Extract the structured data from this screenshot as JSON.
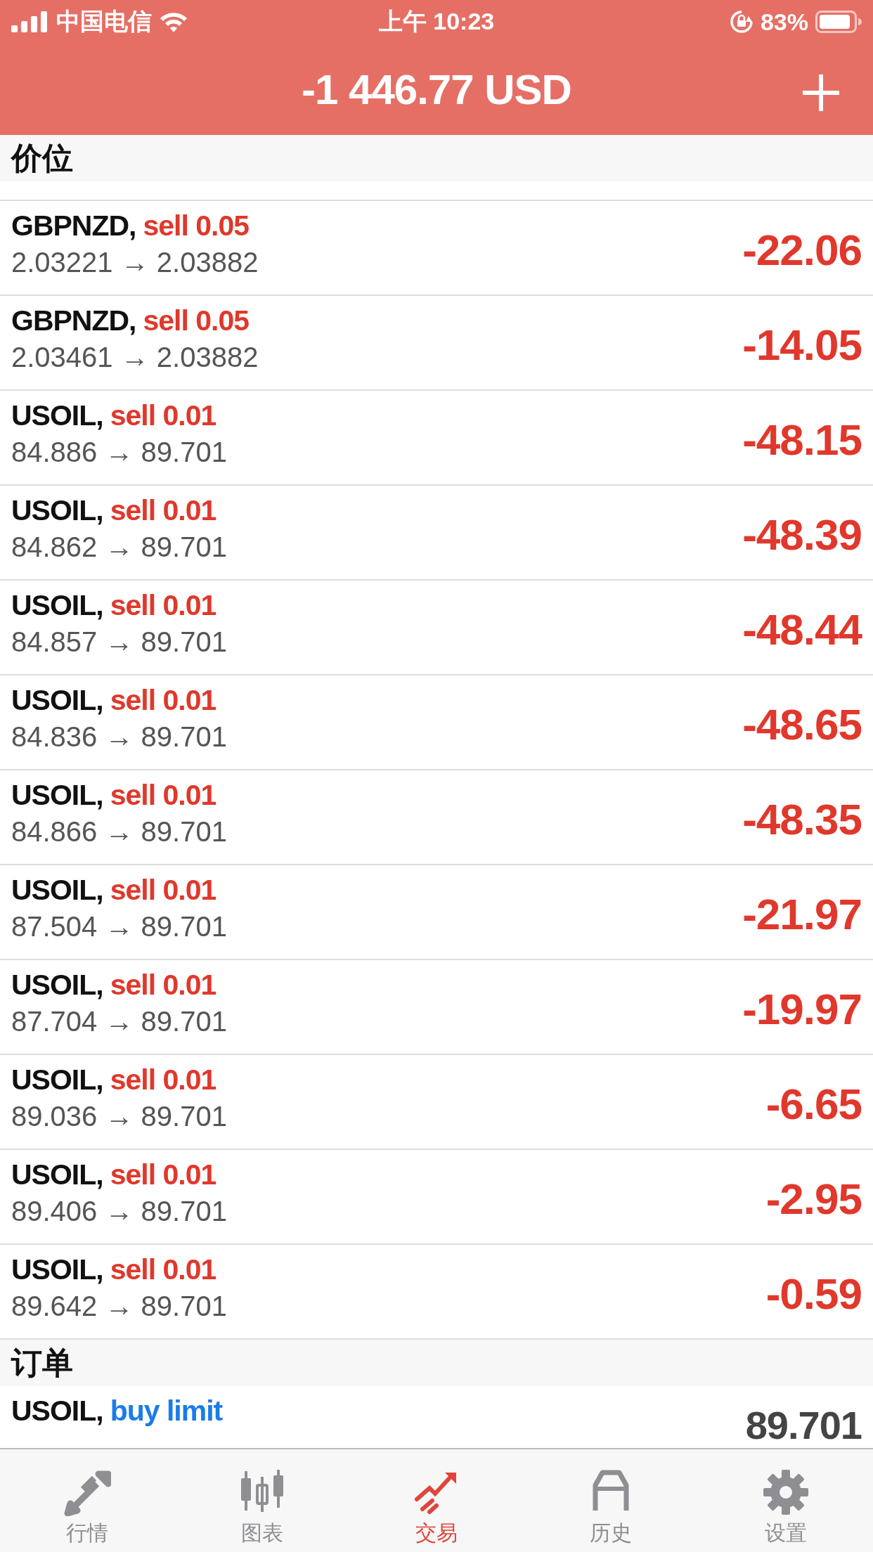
{
  "status_bar": {
    "carrier": "中国电信",
    "time": "上午 10:23",
    "battery": "83%"
  },
  "header": {
    "title": "-1 446.77 USD"
  },
  "sections": [
    {
      "title": "价位",
      "rows": [
        {
          "kind": "position",
          "symbol": "GBPNZD,",
          "action": "sell 0.05",
          "prices": "2.03221 → 2.03882",
          "profit": "-22.06"
        },
        {
          "kind": "position",
          "symbol": "GBPNZD,",
          "action": "sell 0.05",
          "prices": "2.03461 → 2.03882",
          "profit": "-14.05"
        },
        {
          "kind": "position",
          "symbol": "USOIL,",
          "action": "sell 0.01",
          "prices": "84.886 → 89.701",
          "profit": "-48.15"
        },
        {
          "kind": "position",
          "symbol": "USOIL,",
          "action": "sell 0.01",
          "prices": "84.862 → 89.701",
          "profit": "-48.39"
        },
        {
          "kind": "position",
          "symbol": "USOIL,",
          "action": "sell 0.01",
          "prices": "84.857 → 89.701",
          "profit": "-48.44"
        },
        {
          "kind": "position",
          "symbol": "USOIL,",
          "action": "sell 0.01",
          "prices": "84.836 → 89.701",
          "profit": "-48.65"
        },
        {
          "kind": "position",
          "symbol": "USOIL,",
          "action": "sell 0.01",
          "prices": "84.866 → 89.701",
          "profit": "-48.35"
        },
        {
          "kind": "position",
          "symbol": "USOIL,",
          "action": "sell 0.01",
          "prices": "87.504 → 89.701",
          "profit": "-21.97"
        },
        {
          "kind": "position",
          "symbol": "USOIL,",
          "action": "sell 0.01",
          "prices": "87.704 → 89.701",
          "profit": "-19.97"
        },
        {
          "kind": "position",
          "symbol": "USOIL,",
          "action": "sell 0.01",
          "prices": "89.036 → 89.701",
          "profit": "-6.65"
        },
        {
          "kind": "position",
          "symbol": "USOIL,",
          "action": "sell 0.01",
          "prices": "89.406 → 89.701",
          "profit": "-2.95"
        },
        {
          "kind": "position",
          "symbol": "USOIL,",
          "action": "sell 0.01",
          "prices": "89.642 → 89.701",
          "profit": "-0.59"
        }
      ]
    },
    {
      "title": "订单",
      "rows": [
        {
          "kind": "order",
          "symbol": "USOIL,",
          "action": "buy limit",
          "profit": "89.701"
        }
      ]
    }
  ],
  "tabs": [
    {
      "label": "行情",
      "selected": false
    },
    {
      "label": "图表",
      "selected": false
    },
    {
      "label": "交易",
      "selected": true
    },
    {
      "label": "历史",
      "selected": false
    },
    {
      "label": "设置",
      "selected": false
    }
  ]
}
